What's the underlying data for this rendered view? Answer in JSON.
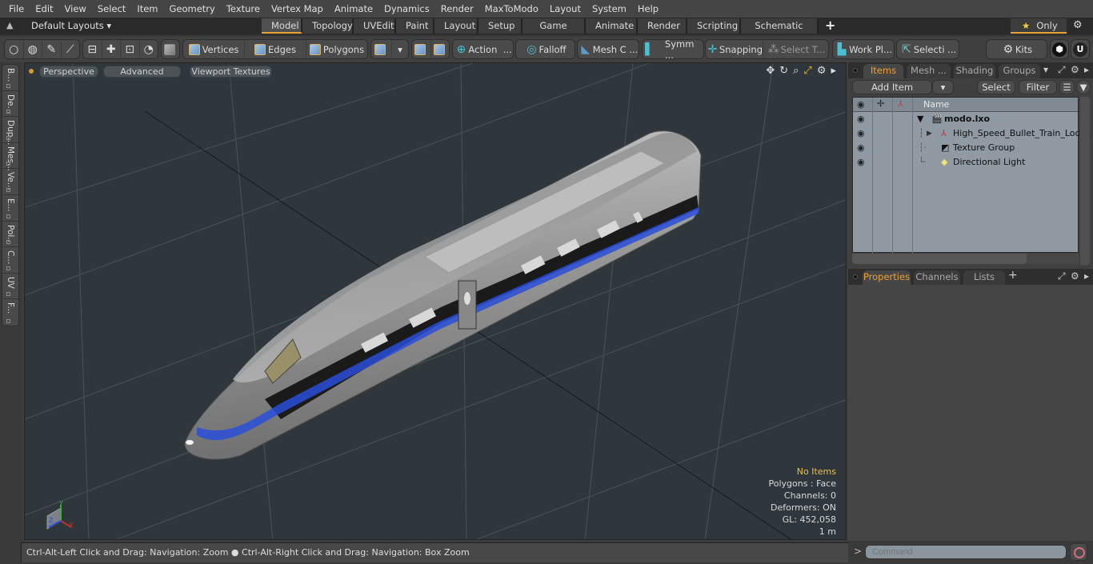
{
  "menubar": {
    "items": [
      "File",
      "Edit",
      "View",
      "Select",
      "Item",
      "Geometry",
      "Texture",
      "Vertex Map",
      "Animate",
      "Dynamics",
      "Render",
      "MaxToModo",
      "Layout",
      "System",
      "Help"
    ]
  },
  "tabbar": {
    "layouts_label": "Default Layouts",
    "tabs": [
      "Model",
      "Topology",
      "UVEdit",
      "Paint",
      "Layout",
      "Setup",
      "Game Tools",
      "Animate",
      "Render",
      "Scripting",
      "Schematic Fusion"
    ],
    "active_tab": "Model",
    "add_tab": "+",
    "only_label": "Only"
  },
  "toolbar": {
    "vertices": "Vertices",
    "edges": "Edges",
    "polygons": "Polygons",
    "action": "Action",
    "action_more": "...",
    "falloff": "Falloff",
    "mesh_c": "Mesh C ...",
    "symm": "Symm ...",
    "snapping": "Snapping",
    "select_t": "Select T...",
    "work_pl": "Work Pl...",
    "selecti": "Selecti ...",
    "kits": "Kits"
  },
  "left_tabs": [
    "B...",
    "De...",
    "Dup...",
    "Mes...",
    "Ve...",
    "E...",
    "Pol...",
    "C...",
    "UV",
    "F..."
  ],
  "viewport": {
    "view_mode": "Perspective",
    "shading": "Advanced",
    "textures": "Viewport Textures",
    "info": {
      "selection": "No Items",
      "polygons": "Polygons : Face",
      "channels": "Channels: 0",
      "deformers": "Deformers: ON",
      "gl": "GL: 452,058",
      "scale": "1 m"
    },
    "axes": {
      "x": "X",
      "y": "Y",
      "z": "Z"
    }
  },
  "statusbar": {
    "hint_left": "Ctrl-Alt-Left Click and Drag: Navigation: Zoom",
    "hint_right": "Ctrl-Alt-Right Click and Drag: Navigation: Box Zoom"
  },
  "items_panel": {
    "tabs": [
      "Items",
      "Mesh ...",
      "Shading",
      "Groups"
    ],
    "active_tab": "Items",
    "add_item": "Add Item",
    "select": "Select",
    "filter": "Filter",
    "column_name": "Name",
    "tree": [
      {
        "label": "modo.lxo",
        "icon": "scene-clapper-icon",
        "expander": "▼"
      },
      {
        "label": "High_Speed_Bullet_Train_Loc ...",
        "icon": "locator-axes-icon",
        "expander": "▶"
      },
      {
        "label": "Texture Group",
        "icon": "texture-group-icon",
        "expander": ""
      },
      {
        "label": "Directional Light",
        "icon": "directional-light-icon",
        "expander": ""
      }
    ]
  },
  "properties_panel": {
    "tabs": [
      "Properties",
      "Channels",
      "Lists"
    ],
    "active_tab": "Properties",
    "add_tab": "+"
  },
  "command": {
    "prompt": ">",
    "placeholder": "Command"
  },
  "colors": {
    "accent": "#e6a33a",
    "viewport_bg": "#2f373c",
    "tree_bg": "#8f9aa3",
    "info_highlight": "#f0c040"
  }
}
